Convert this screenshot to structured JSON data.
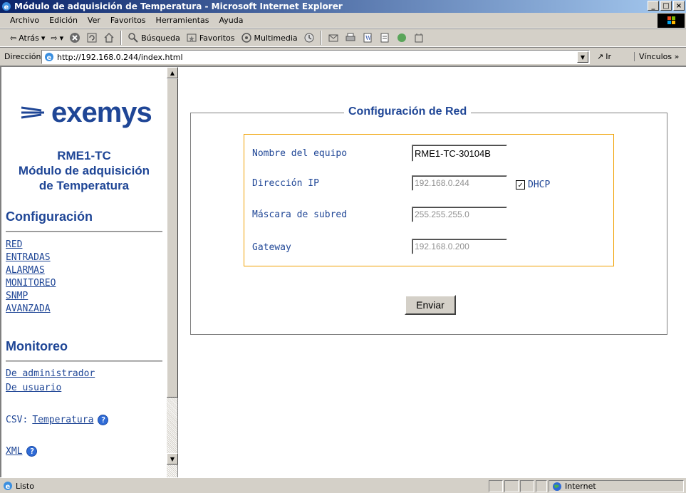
{
  "window": {
    "title": "Módulo de adquisición de Temperatura - Microsoft Internet Explorer",
    "min": "_",
    "max": "□",
    "close": "×"
  },
  "menu": [
    "Archivo",
    "Edición",
    "Ver",
    "Favoritos",
    "Herramientas",
    "Ayuda"
  ],
  "toolbar": {
    "back": "Atrás",
    "search": "Búsqueda",
    "favorites": "Favoritos",
    "multimedia": "Multimedia"
  },
  "address": {
    "label": "Dirección",
    "url": "http://192.168.0.244/index.html",
    "go": "Ir",
    "links": "Vínculos »"
  },
  "sidebar": {
    "logo": "exemys",
    "device_name": "RME1-TC",
    "device_desc_1": "Módulo de adquisición",
    "device_desc_2": "de Temperatura",
    "config_title": "Configuración",
    "config_links": [
      "RED",
      "ENTRADAS",
      "ALARMAS",
      "MONITOREO",
      "SNMP",
      "AVANZADA"
    ],
    "monitor_title": "Monitoreo",
    "monitor_links": [
      "De administrador",
      "De usuario"
    ],
    "csv_label": "CSV:",
    "csv_link": "Temperatura",
    "xml_link": "XML"
  },
  "form": {
    "legend": "Configuración de Red",
    "name_label": "Nombre del equipo",
    "name_value": "RME1-TC-30104B",
    "ip_label": "Dirección IP",
    "ip_value": "192.168.0.244",
    "dhcp_label": "DHCP",
    "dhcp_checked": true,
    "mask_label": "Máscara de subred",
    "mask_value": "255.255.255.0",
    "gateway_label": "Gateway",
    "gateway_value": "192.168.0.200",
    "submit": "Enviar"
  },
  "status": {
    "text": "Listo",
    "zone": "Internet"
  }
}
